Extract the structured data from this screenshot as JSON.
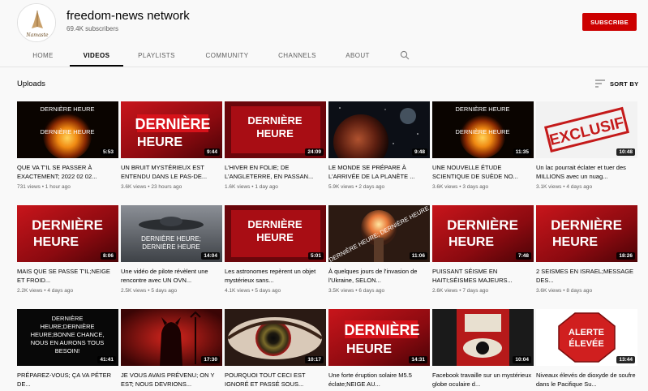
{
  "channel": {
    "name": "freedom-news network",
    "subscribers": "69.4K subscribers",
    "subscribe_label": "SUBSCRIBE",
    "avatar_text": "Namaste"
  },
  "tabs": [
    {
      "label": "HOME"
    },
    {
      "label": "VIDEOS"
    },
    {
      "label": "PLAYLISTS"
    },
    {
      "label": "COMMUNITY"
    },
    {
      "label": "CHANNELS"
    },
    {
      "label": "ABOUT"
    }
  ],
  "section": {
    "title": "Uploads",
    "sort_label": "SORT BY"
  },
  "thumb_texts": {
    "derniere": "DERNIÈRE",
    "heure": "HEURE",
    "derniere_heure": "DERNIÈRE HEURE",
    "exclusif": "EXCLUSIF",
    "alerte": "ALERTE",
    "elevee": "ÉLEVÉE",
    "sun1": "DERNIÈRE HEURE",
    "ufo_line1": "DERNIÈRE HEURE;",
    "ufo_line2": "DERNIÈRE HEURE",
    "nuke_text": "DERNIÈRE HEURE; DERNIÈRE HEURE",
    "text_card": [
      "DERNIÈRE",
      "HEURE;DERNIÈRE",
      "HEURE;BONNE CHANCE,",
      "NOUS EN AURONS TOUS",
      "BESOIN!"
    ]
  },
  "videos": [
    {
      "title": "QUE VA T'IL SE PASSER À EXACTEMENT; 2022 02 02...",
      "views": "731 views",
      "age": "1 hour ago",
      "duration": "5:53"
    },
    {
      "title": "UN BRUIT MYSTÉRIEUX EST ENTENDU DANS LE PAS-DE...",
      "views": "3.6K views",
      "age": "23 hours ago",
      "duration": "9:44"
    },
    {
      "title": "L'HIVER EN FOLIE; DE L'ANGLETERRE, EN PASSAN...",
      "views": "1.6K views",
      "age": "1 day ago",
      "duration": "24:09"
    },
    {
      "title": "LE MONDE SE PRÉPARE À L'ARRIVÉE DE LA PLANÈTE ...",
      "views": "5.9K views",
      "age": "2 days ago",
      "duration": "9:48"
    },
    {
      "title": "UNE NOUVELLE ÉTUDE SCIENTIQUE DE SUÈDE NO...",
      "views": "3.6K views",
      "age": "3 days ago",
      "duration": "11:35"
    },
    {
      "title": "Un lac pourrait éclater et tuer des MILLIONS avec un nuag...",
      "views": "3.1K views",
      "age": "4 days ago",
      "duration": "10:48"
    },
    {
      "title": "MAIS QUE SE PASSE T'IL;NEIGE ET FROID...",
      "views": "2.2K views",
      "age": "4 days ago",
      "duration": "8:06"
    },
    {
      "title": "Une vidéo de pilote révèlent une rencontre avec UN OVN...",
      "views": "2.5K views",
      "age": "5 days ago",
      "duration": "14:04"
    },
    {
      "title": "Les astronomes repèrent un objet mystérieux sans...",
      "views": "4.1K views",
      "age": "5 days ago",
      "duration": "5:01"
    },
    {
      "title": "À quelques jours de l'invasion de l'Ukraine, SELON...",
      "views": "3.5K views",
      "age": "6 days ago",
      "duration": "11:06"
    },
    {
      "title": "PUISSANT SÉISME EN HAITI;SÉISMES MAJEURS...",
      "views": "2.6K views",
      "age": "7 days ago",
      "duration": "7:48"
    },
    {
      "title": "2 SEISMES EN ISRAEL;MESSAGE DES...",
      "views": "3.6K views",
      "age": "8 days ago",
      "duration": "18:26"
    },
    {
      "title": "PRÉPAREZ-VOUS; ÇA VA PÉTER DE...",
      "views": "",
      "age": "",
      "duration": "41:41"
    },
    {
      "title": "JE VOUS AVAIS PRÉVENU; ON Y EST; NOUS DEVRIONS...",
      "views": "",
      "age": "",
      "duration": "17:30"
    },
    {
      "title": "POURQUOI TOUT CECI EST IGNORÉ ET PASSÉ SOUS...",
      "views": "",
      "age": "",
      "duration": "10:17"
    },
    {
      "title": "Une forte éruption solaire M5.5 éclate;NEIGE AU...",
      "views": "",
      "age": "",
      "duration": "14:31"
    },
    {
      "title": "Facebook travaille sur un mystérieux globe oculaire d...",
      "views": "",
      "age": "",
      "duration": "10:04"
    },
    {
      "title": "Niveaux élevés de dioxyde de soufre dans le Pacifique Su...",
      "views": "",
      "age": "",
      "duration": "13:44"
    }
  ],
  "colors": {
    "subscribe": "#cc0000",
    "accent_red": "#d0141b",
    "background": "#f9f9f9"
  }
}
